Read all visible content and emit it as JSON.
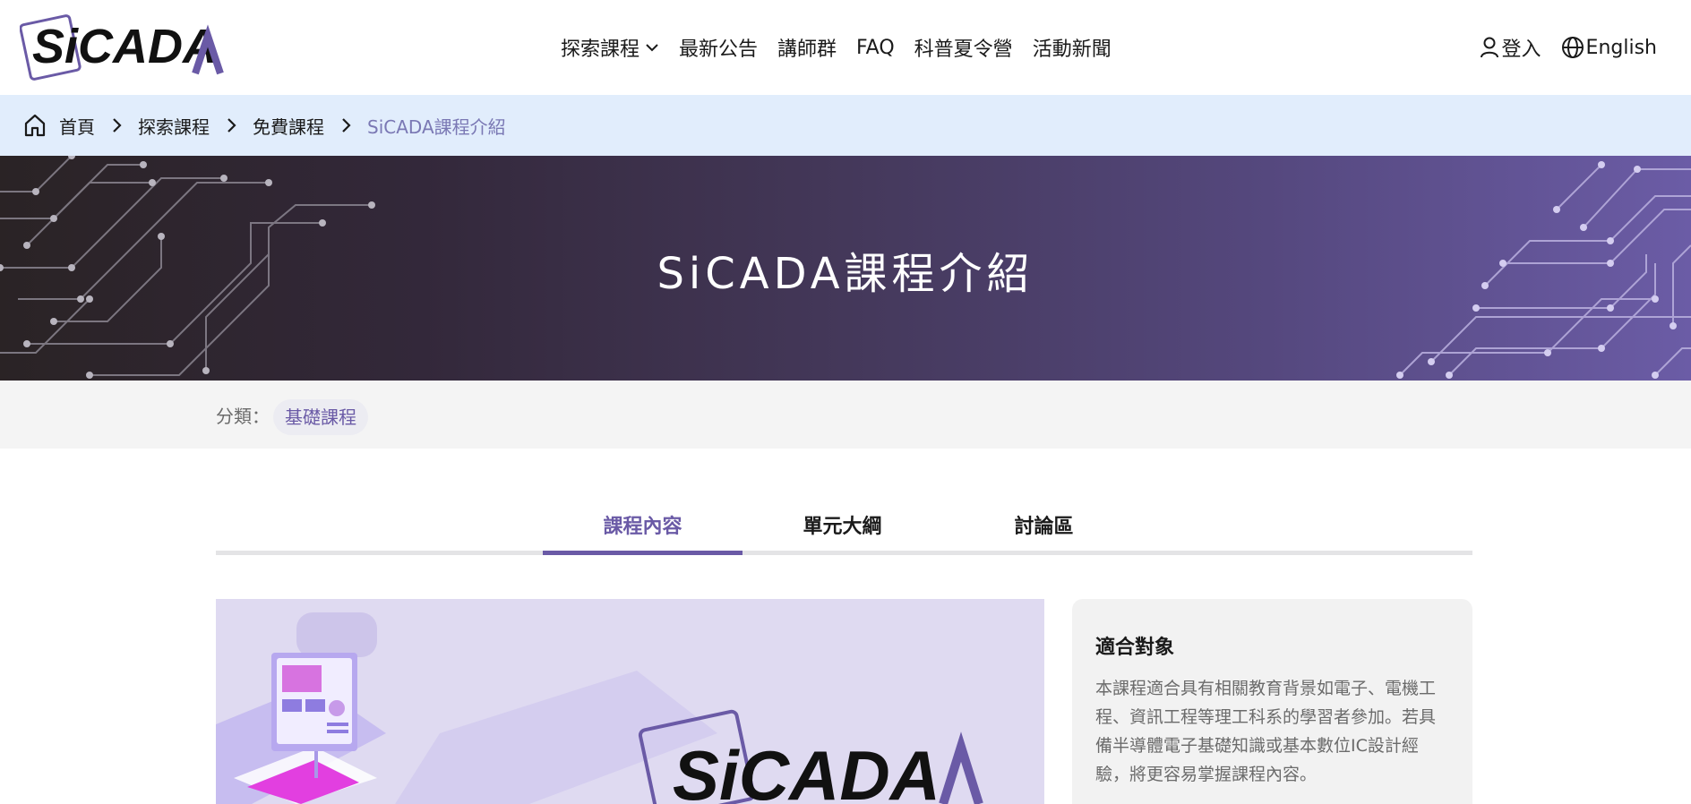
{
  "logo": {
    "text": "SiCADA"
  },
  "nav": {
    "items": [
      {
        "label": "探索課程",
        "has_dropdown": true
      },
      {
        "label": "最新公告"
      },
      {
        "label": "講師群"
      },
      {
        "label": "FAQ"
      },
      {
        "label": "科普夏令營"
      },
      {
        "label": "活動新聞"
      }
    ],
    "login_label": "登入",
    "language_label": "English"
  },
  "breadcrumb": {
    "items": [
      "首頁",
      "探索課程",
      "免費課程",
      "SiCADA課程介紹"
    ]
  },
  "banner": {
    "title": "SiCADA課程介紹"
  },
  "category": {
    "label": "分類：",
    "value": "基礎課程"
  },
  "tabs": [
    {
      "label": "課程內容",
      "active": true
    },
    {
      "label": "單元大綱",
      "active": false
    },
    {
      "label": "討論區",
      "active": false
    }
  ],
  "course_image": {
    "logo_text": "SiCADA"
  },
  "audience": {
    "title": "適合對象",
    "description": "本課程適合具有相關教育背景如電子、電機工程、資訊工程等理工科系的學習者參加。若具備半導體電子基礎知識或基本數位IC設計經驗，將更容易掌握課程內容。"
  },
  "colors": {
    "accent": "#6a5aa6",
    "breadcrumb_bg": "#e1edfc",
    "banner_start": "#2a2325",
    "banner_end": "#6b5ca6"
  }
}
